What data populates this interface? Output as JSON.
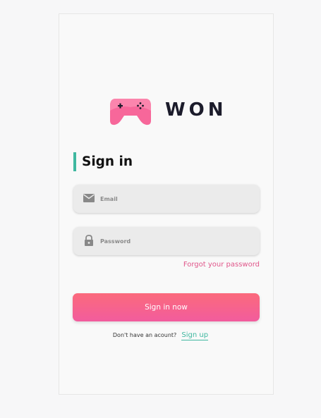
{
  "brand": {
    "name": "WON",
    "logo_icon": "gamepad-icon",
    "accent_pink": "#f7679a",
    "text_color": "#1c1c2b"
  },
  "heading": {
    "title": "Sign in",
    "accent_color": "#3fb8a0"
  },
  "form": {
    "email": {
      "placeholder": "Email",
      "value": "",
      "icon": "envelope-icon"
    },
    "password": {
      "placeholder": "Password",
      "value": "",
      "icon": "lock-icon"
    },
    "forgot_label": "Forgot your password",
    "submit_label": "Sign in now"
  },
  "footer": {
    "prompt": "Don't have an acount?",
    "signup_label": "Sign up"
  },
  "colors": {
    "button_gradient_start": "#fb6a7c",
    "button_gradient_end": "#f25c9d",
    "link_pink": "#e0568a",
    "link_teal": "#3fb8a0"
  }
}
